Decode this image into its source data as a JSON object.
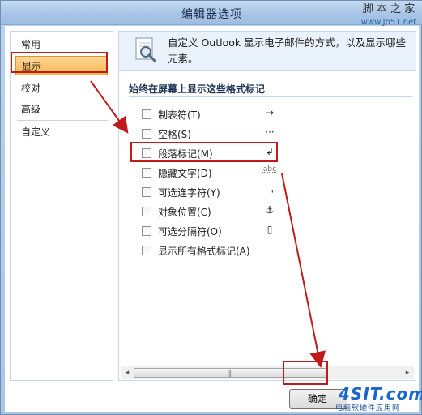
{
  "window": {
    "title": "编辑器选项"
  },
  "watermark_top": {
    "line1": "脚 本 之 家",
    "line2": "www.Jb51.net"
  },
  "sidebar": {
    "items": [
      {
        "label": "常用"
      },
      {
        "label": "显示"
      },
      {
        "label": "校对"
      },
      {
        "label": "高级"
      },
      {
        "label": "自定义"
      }
    ]
  },
  "header": {
    "description": "自定义 Outlook 显示电子邮件的方式，以及显示哪些元素。"
  },
  "section": {
    "title": "始终在屏幕上显示这些格式标记"
  },
  "options": [
    {
      "label": "制表符(T)",
      "symbol": "→"
    },
    {
      "label": "空格(S)",
      "symbol": "···"
    },
    {
      "label": "段落标记(M)",
      "symbol": "↲"
    },
    {
      "label": "隐藏文字(D)",
      "symbol": "abc"
    },
    {
      "label": "可选连字符(Y)",
      "symbol": "¬"
    },
    {
      "label": "对象位置(C)",
      "symbol": "⚓"
    },
    {
      "label": "可选分隔符(O)",
      "symbol": "▯"
    },
    {
      "label": "显示所有格式标记(A)",
      "symbol": ""
    }
  ],
  "scrollbar": {
    "left_arrow": "◂",
    "right_arrow": "▸",
    "grip": "|||"
  },
  "buttons": {
    "ok": "确定"
  },
  "watermark_bottom": {
    "logo": "4SIT.com",
    "subtitle": "电脑软硬件应用网"
  },
  "colors": {
    "highlight": "#c11a1a",
    "selected_nav": "#f8b94e",
    "title_bar": "#a8c5e6"
  }
}
